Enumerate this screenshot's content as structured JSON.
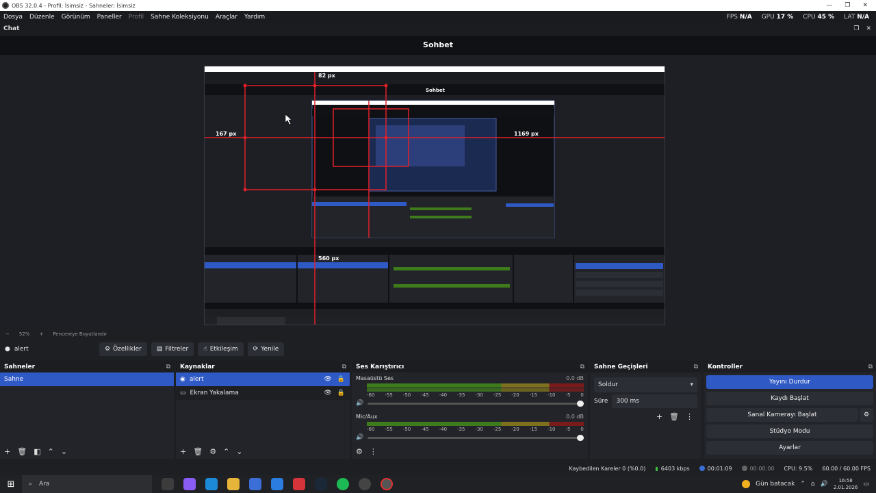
{
  "window": {
    "title": "OBS 32.0.4 - Profil: İsimsiz - Sahneler: İsimsiz"
  },
  "menu": [
    "Dosya",
    "Düzenle",
    "Görünüm",
    "Paneller",
    "Profil",
    "Sahne Koleksiyonu",
    "Araçlar",
    "Yardım"
  ],
  "stats": {
    "fps_label": "FPS",
    "fps": "N/A",
    "gpu_label": "GPU",
    "gpu": "17 %",
    "cpu_label": "CPU",
    "cpu": "45 %",
    "lat_label": "LAT",
    "lat": "N/A"
  },
  "chat_dock": {
    "title": "Chat",
    "heading": "Sohbet"
  },
  "preview": {
    "measure_top": "82 px",
    "measure_left": "167 px",
    "measure_right": "1169 px",
    "measure_bottom": "560 px",
    "nested_heading": "Sohbet"
  },
  "zoom": {
    "minus": "−",
    "level": "52%",
    "plus": "+",
    "fit": "Pencereye Boyutlandır"
  },
  "source_toolbar": {
    "source": "alert",
    "properties": "Özellikler",
    "filters": "Filtreler",
    "interact": "Etkileşim",
    "refresh": "Yenile"
  },
  "scenes": {
    "title": "Sahneler",
    "items": [
      "Sahne"
    ]
  },
  "sources": {
    "title": "Kaynaklar",
    "items": [
      "alert",
      "Ekran Yakalama"
    ]
  },
  "mixer": {
    "title": "Ses Karıştırıcı",
    "channels": [
      {
        "name": "Masaüstü Ses",
        "db": "0.0 dB"
      },
      {
        "name": "Mic/Aux",
        "db": "0.0 dB"
      }
    ],
    "ticks": [
      "-60",
      "-55",
      "-50",
      "-45",
      "-40",
      "-35",
      "-30",
      "-25",
      "-20",
      "-15",
      "-10",
      "-5",
      "0"
    ]
  },
  "transitions": {
    "title": "Sahne Geçişleri",
    "type": "Soldur",
    "duration_label": "Süre",
    "duration": "300 ms"
  },
  "controls": {
    "title": "Kontroller",
    "stop_stream": "Yayını Durdur",
    "start_record": "Kaydı Başlat",
    "virtual_cam": "Sanal Kamerayı Başlat",
    "studio_mode": "Stüdyo Modu",
    "settings": "Ayarlar"
  },
  "status": {
    "dropped": "Kaybedilen Kareler 0 (%0.0)",
    "bitrate": "6403 kbps",
    "stream_time": "00:01:09",
    "rec_time": "00:00:00",
    "cpu": "CPU: 9.5%",
    "fps": "60.00 / 60.00 FPS"
  },
  "taskbar": {
    "search": "Ara",
    "weather": "Gün batacak",
    "time": "16:58",
    "date": "2.01.2026"
  }
}
